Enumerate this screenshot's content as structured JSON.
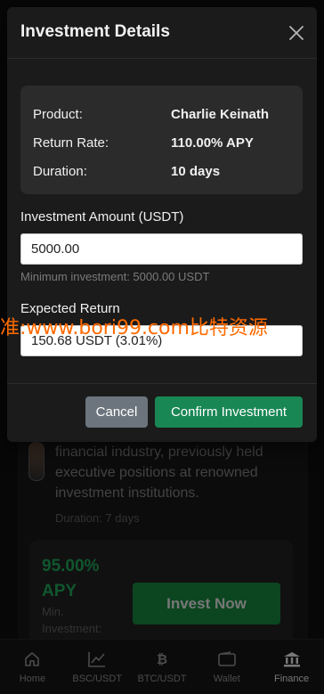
{
  "background": {
    "description": "financial industry, previously held executive positions at renowned investment institutions.",
    "duration": "Duration: 7 days",
    "plan": {
      "rate": "95.00% APY",
      "min": "Min. Investment:",
      "button": "Invest Now"
    }
  },
  "tabbar": {
    "items": [
      {
        "label": "Home",
        "icon": "home-icon"
      },
      {
        "label": "BSC/USDT",
        "icon": "chart-line-icon"
      },
      {
        "label": "BTC/USDT",
        "icon": "bitcoin-icon"
      },
      {
        "label": "Wallet",
        "icon": "wallet-icon"
      },
      {
        "label": "Finance",
        "icon": "bank-icon",
        "active": true
      }
    ]
  },
  "modal": {
    "title": "Investment Details",
    "details": [
      {
        "label": "Product:",
        "value": "Charlie Keinath"
      },
      {
        "label": "Return Rate:",
        "value": "110.00% APY"
      },
      {
        "label": "Duration:",
        "value": "10 days"
      }
    ],
    "amount": {
      "label": "Investment Amount (USDT)",
      "value": "5000.00",
      "hint": "Minimum investment: 5000.00 USDT"
    },
    "expected": {
      "label": "Expected Return",
      "value": "150.68 USDT (3.01%)"
    },
    "buttons": {
      "cancel": "Cancel",
      "confirm": "Confirm Investment"
    }
  },
  "watermark": "准:www.bori99.com比特资源",
  "colors": {
    "accent": "#198754",
    "rate": "#1f9d55",
    "cancel": "#6c757d",
    "watermark": "#ff6a00"
  }
}
